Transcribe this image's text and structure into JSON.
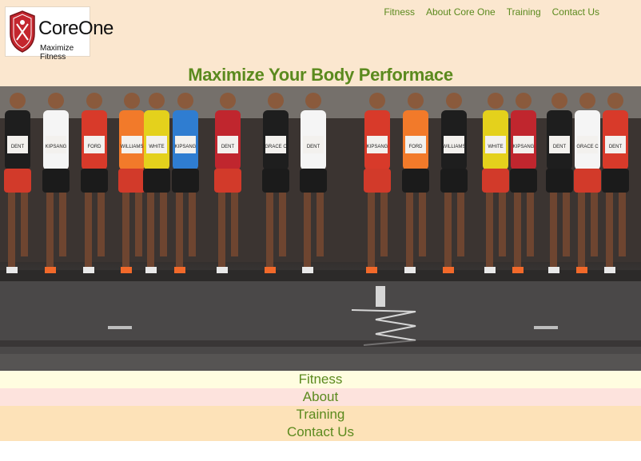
{
  "brand": {
    "name": "CoreOne",
    "tagline": "Maximize Fitness",
    "logo_icon": "shield-crest-icon"
  },
  "nav": {
    "items": [
      {
        "label": "Fitness"
      },
      {
        "label": "About Core One"
      },
      {
        "label": "Training"
      },
      {
        "label": "Contact Us"
      }
    ]
  },
  "headline": "Maximize Your Body Performace",
  "hero": {
    "bibs": [
      "DENT",
      "KIPSANG",
      "FORD",
      "WILLIAMS",
      "WHITE",
      "KIPSANG",
      "DENT",
      "GRACE C"
    ]
  },
  "menu": {
    "items": [
      {
        "label": "Fitness"
      },
      {
        "label": "About"
      },
      {
        "label": "Training"
      },
      {
        "label": "Contact Us"
      }
    ]
  },
  "colors": {
    "header_bg": "#fbe7cf",
    "accent_green": "#5b8a1e",
    "menu_fitness_bg": "#fffde0",
    "menu_about_bg": "#fde3dd",
    "menu_training_bg": "#fde2b8"
  }
}
